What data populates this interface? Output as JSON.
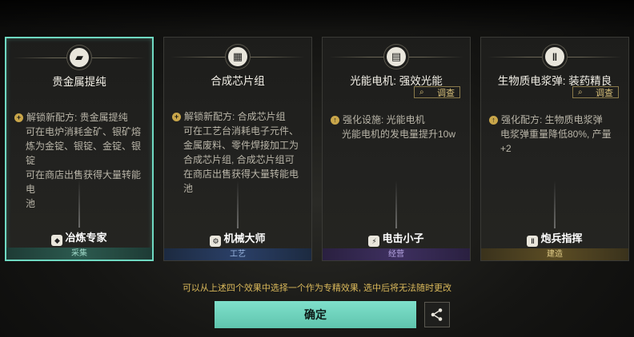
{
  "cards": [
    {
      "title": "贵金属提纯",
      "icon": "gold-ingot-icon",
      "inspect": "",
      "desc_lines": [
        "解锁新配方: 贵金属提纯",
        "可在电炉消耗金矿、银矿熔",
        "炼为金锭、银锭、金锭、银锭",
        "可在商店出售获得大量转能电",
        "池"
      ],
      "spec": "冶炼专家",
      "category": "采集"
    },
    {
      "title": "合成芯片组",
      "icon": "chip-icon",
      "inspect": "",
      "desc_lines": [
        "解锁新配方: 合成芯片组",
        "可在工艺台消耗电子元件、",
        "金属废料、零件焊接加工为",
        "合成芯片组, 合成芯片组可",
        "在商店出售获得大量转能电",
        "池"
      ],
      "spec": "机械大师",
      "category": "工艺"
    },
    {
      "title": "光能电机: 强效光能",
      "icon": "motor-icon",
      "inspect": "调查",
      "desc_lines": [
        "强化设施: 光能电机",
        "光能电机的发电量提升10w"
      ],
      "spec": "电击小子",
      "category": "经营"
    },
    {
      "title": "生物质电浆弹: 装药精良",
      "icon": "shell-icon",
      "inspect": "调查",
      "desc_lines": [
        "强化配方: 生物质电浆弹",
        "电浆弹重量降低80%, 产量",
        "+2"
      ],
      "spec": "炮兵指挥",
      "category": "建造"
    }
  ],
  "hint": "可以从上述四个效果中选择一个作为专精效果, 选中后将无法随时更改",
  "confirm_label": "确定",
  "share_icon": "share-icon"
}
